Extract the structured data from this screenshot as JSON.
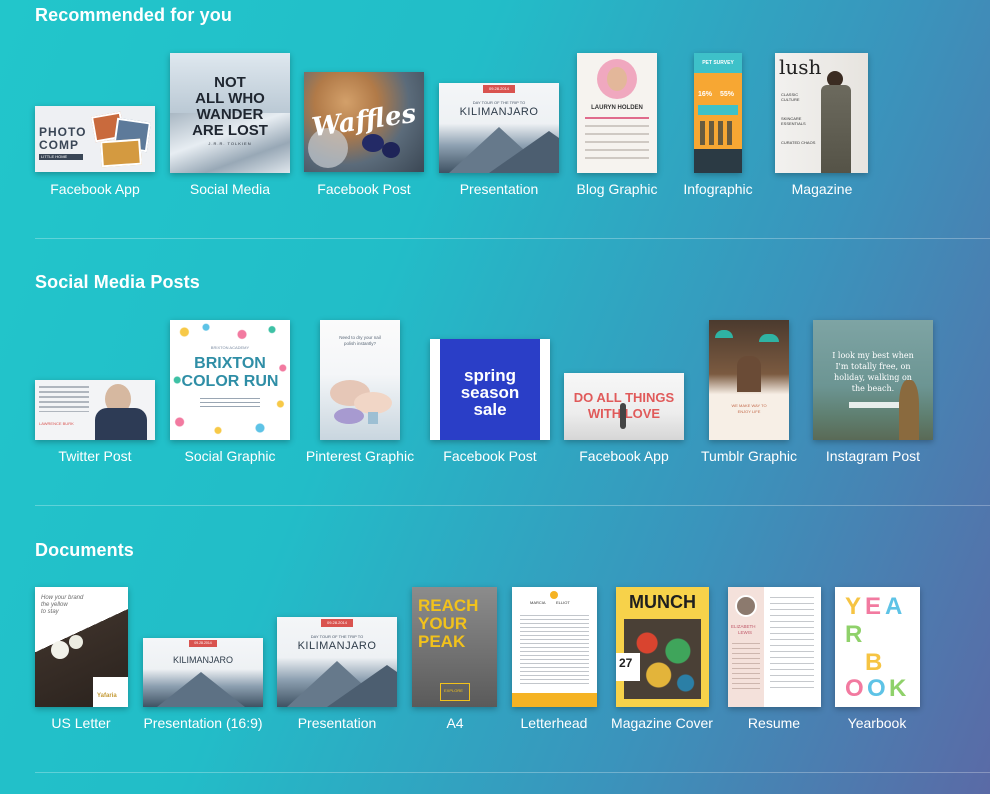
{
  "sections": [
    {
      "title": "Recommended for you",
      "items": [
        {
          "label": "Facebook App",
          "lines": [
            "PHOTO",
            "COMP",
            "LITTLE HOME"
          ]
        },
        {
          "label": "Social Media",
          "lines": [
            "NOT",
            "ALL WHO",
            "WANDER",
            "ARE LOST",
            "J.R.R. TOLKIEN"
          ]
        },
        {
          "label": "Facebook Post",
          "lines": [
            "Waffles"
          ]
        },
        {
          "label": "Presentation",
          "lines": [
            "09.28.2014",
            "DAY TOUR OF THE TRIP TO",
            "KILIMANJARO"
          ]
        },
        {
          "label": "Blog Graphic",
          "lines": [
            "LAURYN HOLDEN"
          ]
        },
        {
          "label": "Infographic",
          "lines": [
            "PET SURVEY",
            "16%",
            "55%"
          ]
        },
        {
          "label": "Magazine",
          "lines": [
            "lush",
            "CLASSIC CULTURE",
            "SKINCARE ESSENTIALS",
            "CURATED CHAOS"
          ]
        }
      ]
    },
    {
      "title": "Social Media Posts",
      "items": [
        {
          "label": "Twitter Post",
          "lines": [
            "LAWRENCE BURK"
          ]
        },
        {
          "label": "Social Graphic",
          "lines": [
            "BRIXTON",
            "COLOR RUN",
            "BRIXTON ACADEMY"
          ]
        },
        {
          "label": "Pinterest Graphic",
          "lines": [
            "Need to dry your nail",
            "polish instantly?"
          ]
        },
        {
          "label": "Facebook Post",
          "lines": [
            "spring",
            "season",
            "sale"
          ]
        },
        {
          "label": "Facebook App",
          "lines": [
            "DO ALL THINGS",
            "WITH LOVE"
          ]
        },
        {
          "label": "Tumblr Graphic",
          "lines": [
            "WE MAKE WAY TO",
            "ENJOY LIFE"
          ]
        },
        {
          "label": "Instagram Post",
          "lines": [
            "I look my best when",
            "I'm totally free, on",
            "holiday, walking on",
            "the beach."
          ]
        }
      ]
    },
    {
      "title": "Documents",
      "items": [
        {
          "label": "US Letter",
          "lines": [
            "How your brand",
            "the yellow",
            "to stay",
            "Yafaria"
          ]
        },
        {
          "label": "Presentation (16:9)",
          "lines": [
            "09.28.2014",
            "KILIMANJARO"
          ]
        },
        {
          "label": "Presentation",
          "lines": [
            "09.28.2014",
            "DAY TOUR OF THE TRIP TO",
            "KILIMANJARO"
          ]
        },
        {
          "label": "A4",
          "lines": [
            "REACH",
            "YOUR",
            "PEAK",
            "EXPLORE"
          ]
        },
        {
          "label": "Letterhead",
          "lines": [
            "MARCIA",
            "ELLIOT"
          ]
        },
        {
          "label": "Magazine Cover",
          "lines": [
            "MUNCH",
            "27"
          ]
        },
        {
          "label": "Resume",
          "lines": [
            "ELIZABETH",
            "LEWIS"
          ]
        },
        {
          "label": "Yearbook",
          "lines": [
            "Y",
            "E",
            "A",
            "R",
            "B",
            "O",
            "O",
            "K"
          ]
        }
      ]
    }
  ]
}
